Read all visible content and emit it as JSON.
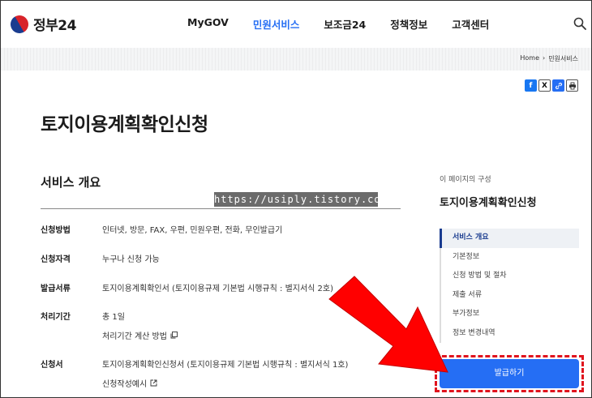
{
  "header": {
    "logo_text": "정부24",
    "nav": [
      {
        "label": "MyGOV",
        "active": false
      },
      {
        "label": "민원서비스",
        "active": true
      },
      {
        "label": "보조금24",
        "active": false
      },
      {
        "label": "정책정보",
        "active": false
      },
      {
        "label": "고객센터",
        "active": false
      }
    ],
    "search_icon": "search-icon"
  },
  "breadcrumb": {
    "home": "Home",
    "separator": "›",
    "current": "민원서비스"
  },
  "share_icons": [
    "facebook-icon",
    "x-icon",
    "link-icon",
    "print-icon"
  ],
  "page_title": "토지이용계획확인신청",
  "overview": {
    "title": "서비스 개요",
    "rows": [
      {
        "label": "신청방법",
        "value": "인터넷, 방문, FAX, 우편, 민원우편, 전화, 무인발급기"
      },
      {
        "label": "신청자격",
        "value": "누구나 신청 가능"
      },
      {
        "label": "발급서류",
        "value": "토지이용계획확인서 (토지이용규제 기본법 시행규칙 : 별지서식 2호)"
      },
      {
        "label": "처리기간",
        "value": "총 1일",
        "sub": "처리기간 계산 방법"
      },
      {
        "label": "신청서",
        "value": "토지이용계획확인신청서 (토지이용규제 기본법 시행규칙 : 별지서식 1호)",
        "sub": "신청작성예시"
      }
    ]
  },
  "watermark": "https://usiply.tistory.com",
  "toc": {
    "head": "이 페이지의 구성",
    "title": "토지이용계획확인신청",
    "items": [
      "서비스 개요",
      "기본정보",
      "신청 방법 및 절차",
      "제출 서류",
      "부가정보",
      "정보 변경내역"
    ],
    "active_index": 0
  },
  "issue_button": "발급하기",
  "colors": {
    "accent": "#256ef4",
    "annotation": "#e0141e",
    "navy": "#1a3c8f"
  }
}
